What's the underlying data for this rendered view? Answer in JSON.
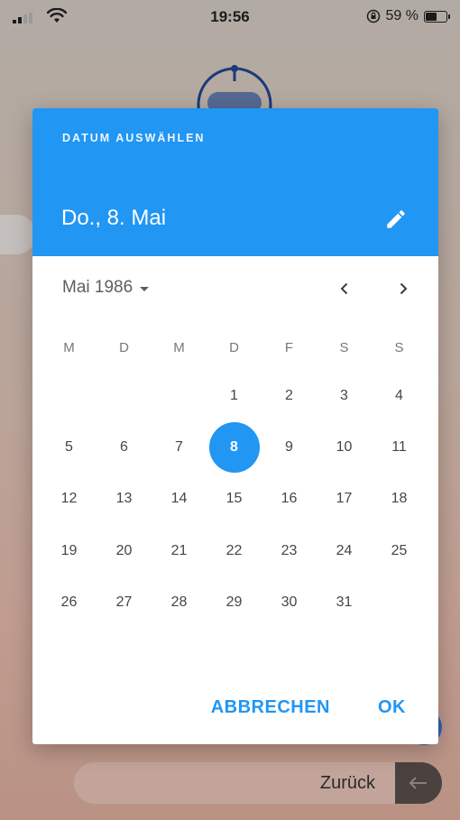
{
  "statusbar": {
    "time": "19:56",
    "battery": "59 %",
    "battery_level": 0.59
  },
  "background": {
    "back_label": "Zurück"
  },
  "dialog": {
    "overline": "DATUM AUSWÄHLEN",
    "selected_date": "Do., 8. Mai",
    "month_label": "Mai 1986",
    "weekdays": [
      "M",
      "D",
      "M",
      "D",
      "F",
      "S",
      "S"
    ],
    "leading_blanks": 3,
    "days": [
      "1",
      "2",
      "3",
      "4",
      "5",
      "6",
      "7",
      "8",
      "9",
      "10",
      "11",
      "12",
      "13",
      "14",
      "15",
      "16",
      "17",
      "18",
      "19",
      "20",
      "21",
      "22",
      "23",
      "24",
      "25",
      "26",
      "27",
      "28",
      "29",
      "30",
      "31"
    ],
    "selected_day": "8",
    "cancel_label": "ABBRECHEN",
    "ok_label": "OK"
  },
  "colors": {
    "accent": "#2196f3",
    "text_dark": "#464646"
  },
  "icons": {
    "edit": "pencil-icon",
    "prev": "chevron-left-icon",
    "next": "chevron-right-icon",
    "dropdown": "caret-down-icon",
    "back": "arrow-left-icon"
  }
}
